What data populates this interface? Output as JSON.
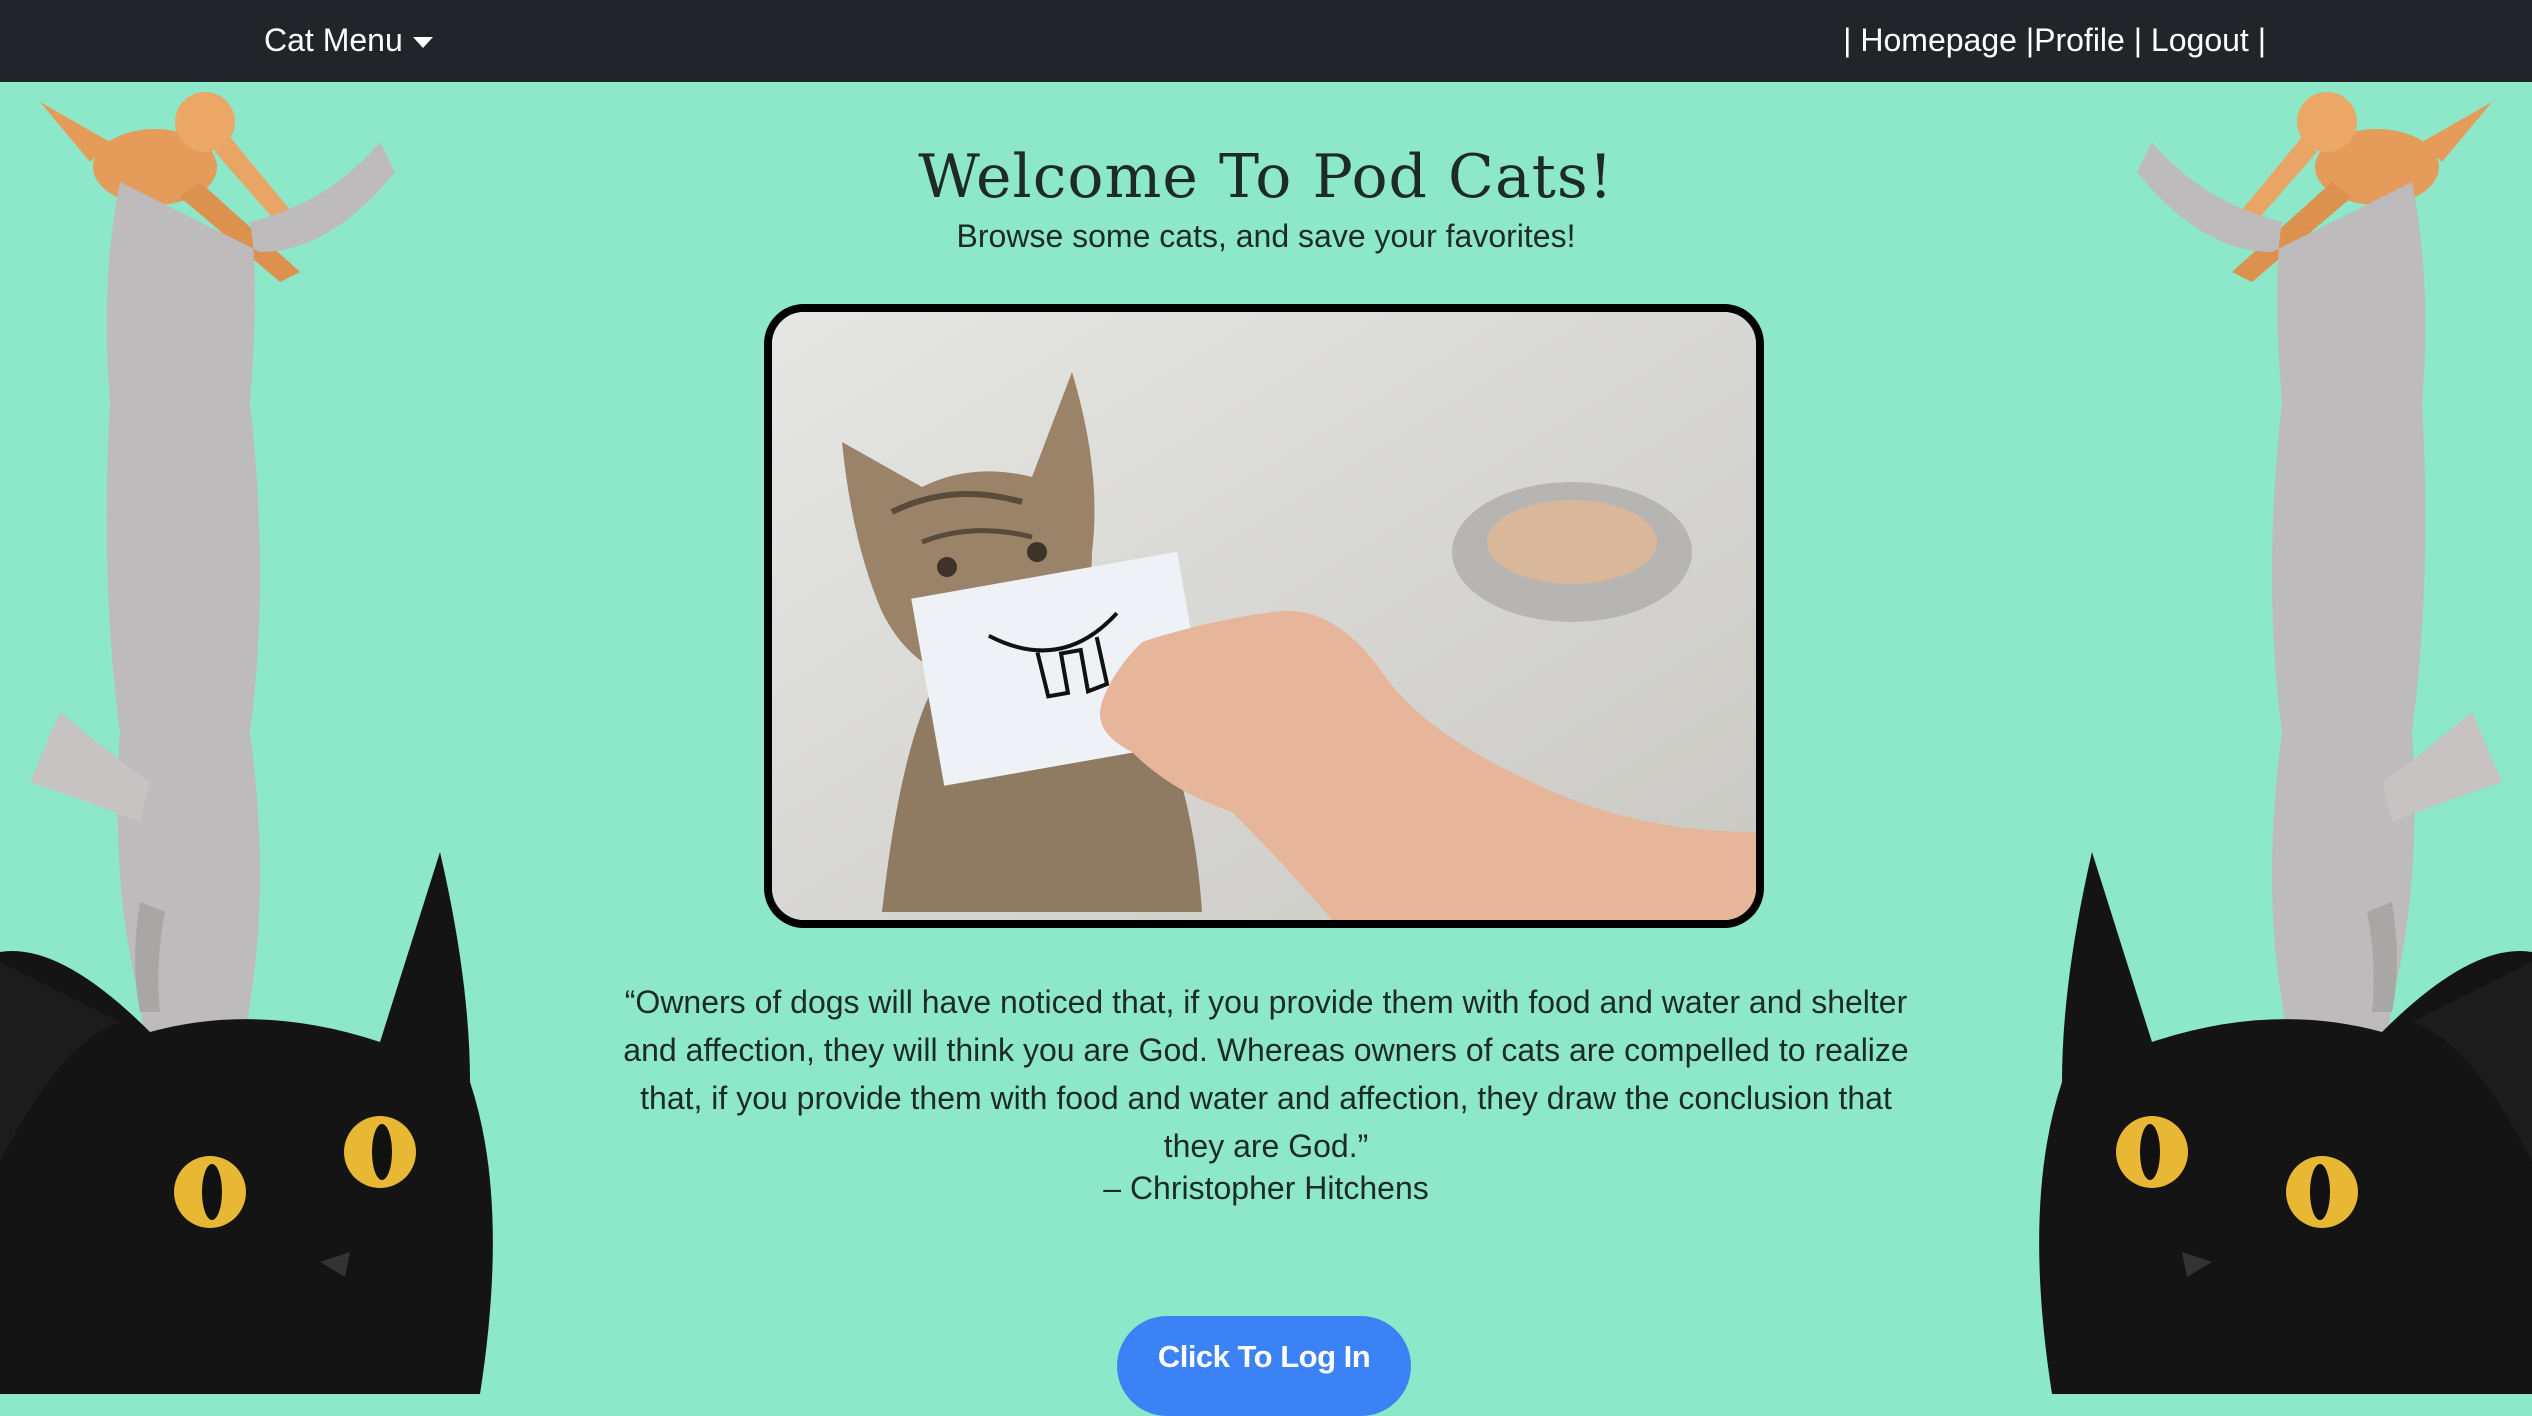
{
  "nav": {
    "brand": "Cat Menu",
    "sep1": "| ",
    "homepage": "Homepage",
    "sep2": " |",
    "profile": "Profile",
    "sep3": " | ",
    "logout": "Logout",
    "sep4": " |"
  },
  "main": {
    "title": "Welcome To Pod Cats!",
    "subtitle": "Browse some cats, and save your favorites!",
    "quote": "“Owners of dogs will have noticed that, if you provide them with food and water and shelter and affection, they will think you are God. Whereas owners of cats are compelled to realize that, if you provide them with food and water and affection, they draw the conclusion that they are God.”",
    "author": "– Christopher Hitchens",
    "login_button": "Click To Log In"
  },
  "colors": {
    "background": "#8ce8c8",
    "navbar": "#212529",
    "button": "#3b82f6"
  },
  "images": {
    "hero": "kitten-holding-smile-card",
    "decor": "stretched-cat-on-black-cat"
  }
}
